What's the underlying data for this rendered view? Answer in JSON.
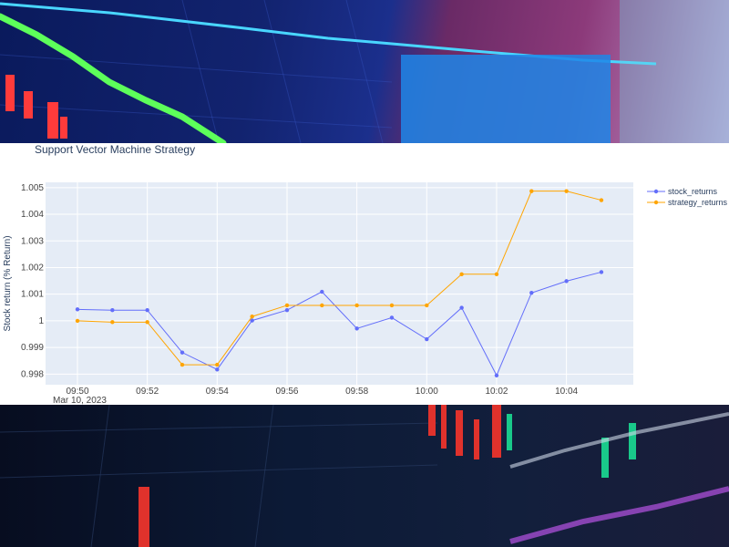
{
  "chart_data": {
    "type": "line",
    "title": "Support Vector Machine Strategy",
    "xlabel": "",
    "ylabel": "Stock return (% Return)",
    "x": [
      "09:50",
      "09:51",
      "09:52",
      "09:53",
      "09:54",
      "09:55",
      "09:56",
      "09:57",
      "09:58",
      "09:59",
      "10:00",
      "10:01",
      "10:02",
      "10:03",
      "10:04",
      "10:05"
    ],
    "x_ticks": [
      "09:50",
      "09:52",
      "09:54",
      "09:56",
      "09:58",
      "10:00",
      "10:02",
      "10:04"
    ],
    "x_date_label": "Mar 10, 2023",
    "ylim": [
      0.9976,
      1.0052
    ],
    "y_ticks": [
      0.998,
      0.999,
      1,
      1.001,
      1.002,
      1.003,
      1.004,
      1.005
    ],
    "y_tick_labels": [
      "0.998",
      "0.999",
      "1",
      "1.001",
      "1.002",
      "1.003",
      "1.004",
      "1.005"
    ],
    "series": [
      {
        "name": "stock_returns",
        "color": "#636efa",
        "values": [
          1.00043,
          1.0004,
          1.0004,
          0.99881,
          0.99817,
          1.00001,
          1.0004,
          1.00109,
          0.99971,
          1.00012,
          0.99931,
          1.00049,
          0.99795,
          1.00105,
          1.00149,
          1.00183
        ]
      },
      {
        "name": "strategy_returns",
        "color": "#ffa500",
        "values": [
          1.0,
          0.99995,
          0.99995,
          0.99835,
          0.99835,
          1.00016,
          1.00058,
          1.00058,
          1.00058,
          1.00058,
          1.00058,
          1.00175,
          1.00175,
          1.00487,
          1.00487,
          1.00453
        ]
      }
    ],
    "grid": true,
    "legend_position": "top-right"
  }
}
